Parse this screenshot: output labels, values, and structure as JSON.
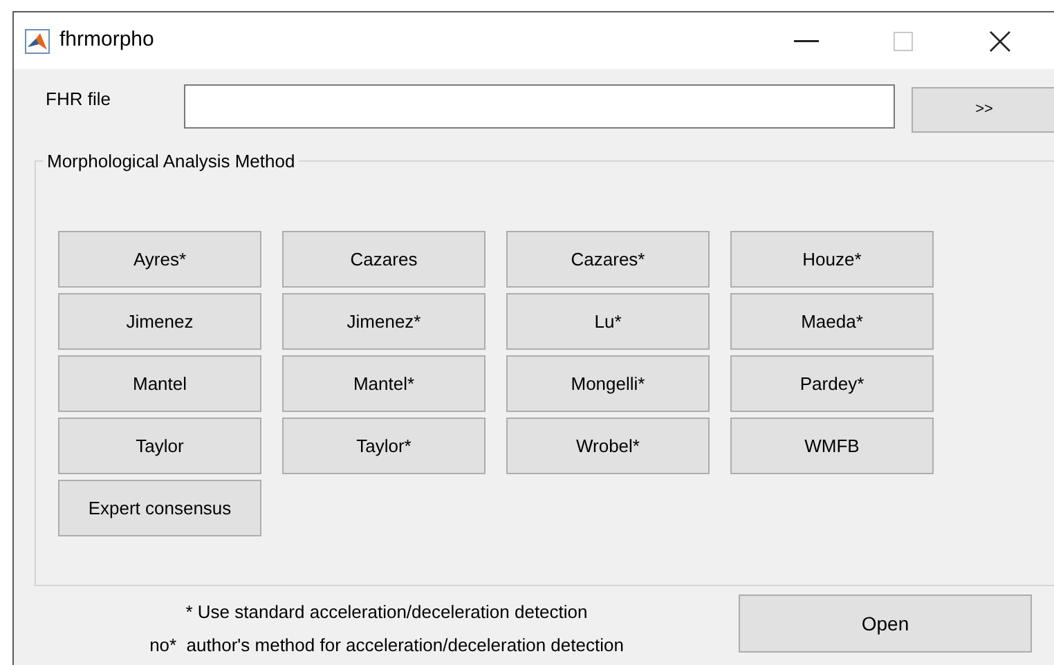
{
  "window": {
    "title": "fhrmorpho"
  },
  "file_field": {
    "label": "FHR file",
    "browse_button": ">>"
  },
  "group": {
    "title": "Morphological Analysis Method",
    "methods": [
      "Ayres*",
      "Cazares",
      "Cazares*",
      "Houze*",
      "Jimenez",
      "Jimenez*",
      "Lu*",
      "Maeda*",
      "Mantel",
      "Mantel*",
      "Mongelli*",
      "Pardey*",
      "Taylor",
      "Taylor*",
      "Wrobel*",
      "WMFB",
      "Expert consensus"
    ]
  },
  "notes": [
    "* Use standard acceleration/deceleration detection",
    "no*  author's method for acceleration/deceleration detection"
  ],
  "open_button": "Open"
}
